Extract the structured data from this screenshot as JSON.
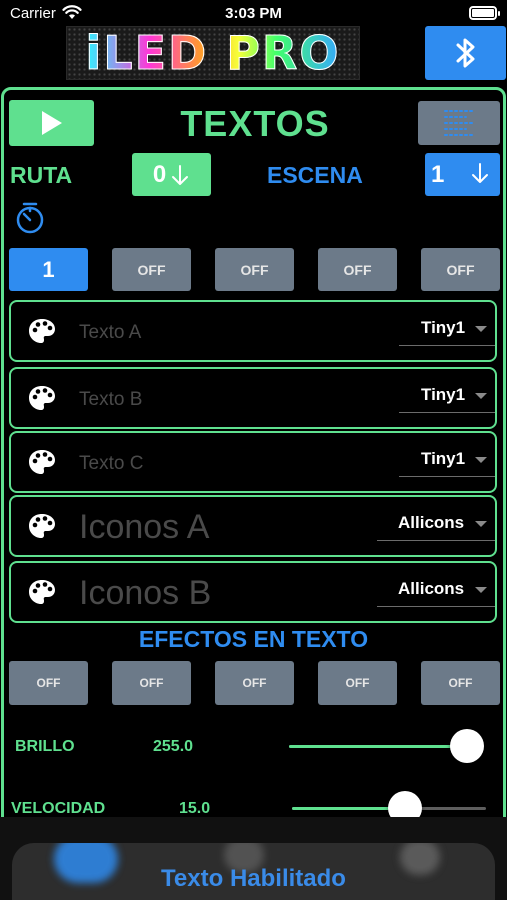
{
  "status_bar": {
    "carrier": "Carrier",
    "time": "3:03 PM"
  },
  "header": {
    "logo_text": "iLED PRO",
    "bluetooth_icon": "bluetooth-icon"
  },
  "main": {
    "title": "TEXTOS",
    "play_icon": "play-icon",
    "list_icon": "list-icon",
    "ruta_label": "RUTA",
    "ruta_value": "0",
    "escena_label": "ESCENA",
    "escena_value": "1",
    "timer_icon": "timer-icon"
  },
  "slots": [
    "1",
    "OFF",
    "OFF",
    "OFF",
    "OFF"
  ],
  "fields": [
    {
      "placeholder": "Texto A",
      "font": "Tiny1"
    },
    {
      "placeholder": "Texto B",
      "font": "Tiny1"
    },
    {
      "placeholder": "Texto C",
      "font": "Tiny1"
    },
    {
      "placeholder": "Iconos A",
      "font": "Allicons"
    },
    {
      "placeholder": "Iconos B",
      "font": "Allicons"
    }
  ],
  "effects": {
    "title": "EFECTOS EN TEXTO",
    "buttons": [
      "OFF",
      "OFF",
      "OFF",
      "OFF",
      "OFF"
    ]
  },
  "sliders": {
    "brillo": {
      "label": "BRILLO",
      "value": "255.0",
      "fraction": 1.0
    },
    "velocidad": {
      "label": "VELOCIDAD",
      "value": "15.0",
      "fraction": 0.58
    }
  },
  "toast": {
    "message": "Texto Habilitado"
  },
  "colors": {
    "green": "#5fe08f",
    "blue": "#2f8cf0",
    "gray": "#6c7a89"
  }
}
